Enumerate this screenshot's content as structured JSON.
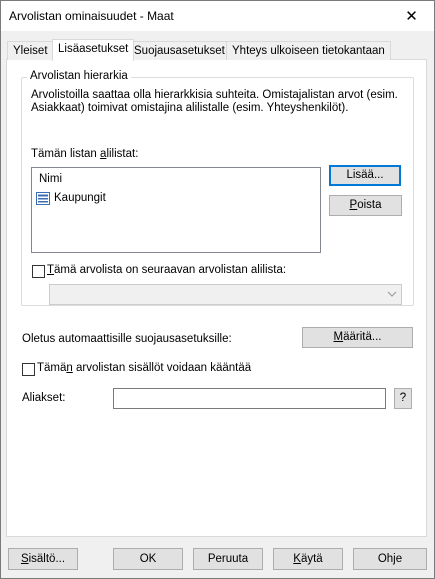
{
  "window": {
    "title": "Arvolistan ominaisuudet - Maat",
    "close_glyph": "✕"
  },
  "tabs": [
    "Yleiset",
    "Lisäasetukset",
    "Suojausasetukset",
    "Yhteys ulkoiseen tietokantaan"
  ],
  "hierarchy": {
    "group_title": "Arvolistan hierarkia",
    "description_line1": "Arvolistoilla saattaa olla hierarkkisia suhteita. Omistajalistan arvot (esim.",
    "description_line2": "Asiakkaat) toimivat omistajina alilistalle (esim. Yhteyshenkilöt).",
    "sublists_label_pre": "Tämän listan ",
    "sublists_label_u": "a",
    "sublists_label_post": "lilistat:",
    "column_header": "Nimi",
    "items": [
      "Kaupungit"
    ],
    "add_button": "Lisää...",
    "remove_button_u": "P",
    "remove_button_post": "oista",
    "is_sublist_u": "T",
    "is_sublist_post": "ämä arvolista on seuraavan arvolistan alilista:",
    "is_sublist_checked": false,
    "parent_select_value": ""
  },
  "security": {
    "label": "Oletus automaattisille suojausasetuksille:",
    "button_u": "M",
    "button_post": "ääritä..."
  },
  "translatable": {
    "pre": "Tämä",
    "u": "n",
    "post": " arvolistan sisällöt voidaan kääntää",
    "checked": false
  },
  "aliases": {
    "label": "Aliakset:",
    "value": "",
    "help_button": "?"
  },
  "footer": {
    "contents_u": "S",
    "contents_post": "isältö...",
    "ok": "OK",
    "cancel": "Peruuta",
    "apply_u": "K",
    "apply_post": "äytä",
    "help": "Ohje"
  }
}
